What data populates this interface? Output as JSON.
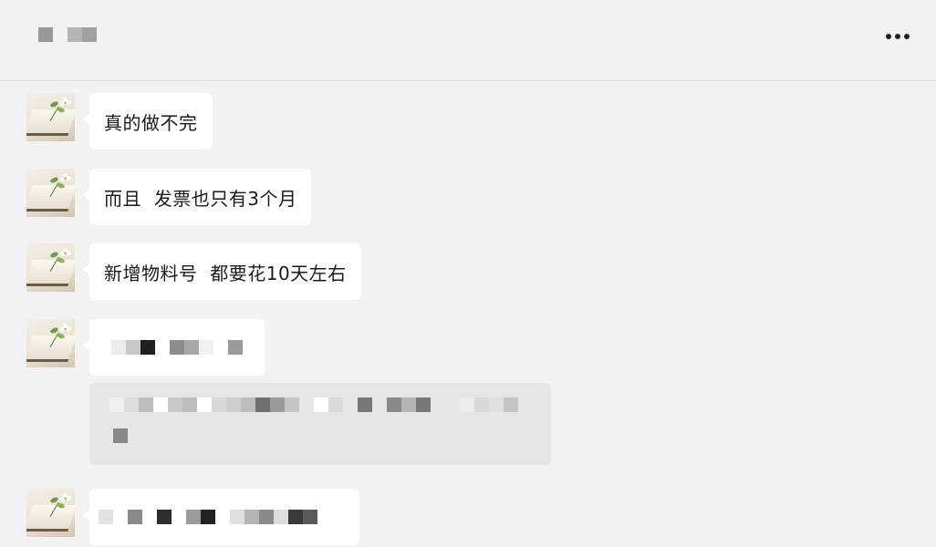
{
  "header": {
    "title_pixels": [
      "#999999",
      "#f2f2f2",
      "#b5b5b5",
      "#a0a0a0"
    ],
    "more_icon": "more-dots-icon"
  },
  "messages": [
    {
      "text": "真的做不完"
    },
    {
      "text": "而且  发票也只有3个月"
    },
    {
      "text": "新增物料号  都要花10天左右"
    },
    {
      "pixels": [
        "#ebebeb",
        "#c8c8c8",
        "#1f1f1f",
        "#ffffff",
        "#8c8c8c",
        "#a8a8a8",
        "#f2f2f2",
        "#ffffff",
        "#9a9a9a"
      ]
    },
    {
      "pixels": [
        "#e2e2e2",
        "#ffffff",
        "#8a8a8a",
        "#ffffff",
        "#2d2d2d",
        "#ffffff",
        "#9b9b9b",
        "#222222",
        "#ffffff",
        "#e0e0e0",
        "#b5b5b5",
        "#8a8a8a",
        "#dcdcdc",
        "#3a3a3a",
        "#5a5a5a"
      ]
    }
  ],
  "quote": {
    "line1_pixels": [
      "#f0f0f0",
      "#dcdcdc",
      "#bdbdbd",
      "#ffffff",
      "#c9c9c9",
      "#bdbdbd",
      "#ffffff",
      "#d7d7d7",
      "#cfcfcf",
      "#bdbdbd",
      "#6e6e6e",
      "#9a9a9a",
      "#c6c6c6",
      "#e6e6e6",
      "#ffffff",
      "#dadada",
      "#e6e6e6",
      "#777777",
      "#e6e6e6",
      "#8a8a8a",
      "#b5b5b5",
      "#777777",
      "#e6e6e6",
      "#e6e6e6",
      "#ededed",
      "#d9d9d9",
      "#dfdfdf",
      "#c5c5c5"
    ],
    "line2_pixels": [
      "#8a8a8a"
    ]
  }
}
